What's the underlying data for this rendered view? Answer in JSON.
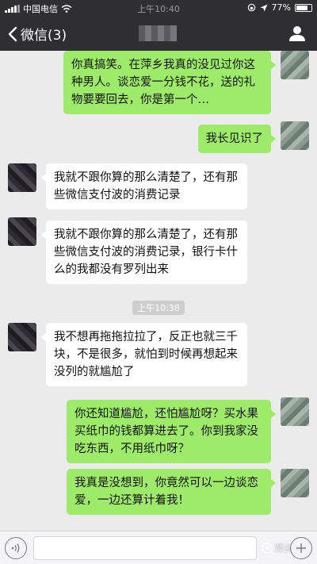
{
  "status_bar": {
    "carrier": "中国电信",
    "time": "上午10:40",
    "battery": "77%",
    "battery_level": 0.77
  },
  "nav": {
    "back_label": "微信(3)"
  },
  "messages": [
    {
      "side": "self",
      "text": "你真搞笑。在萍乡我真的没见过你这种男人。谈恋爱一分钱不花，送的礼物要要回去，你是第一个…"
    },
    {
      "side": "self",
      "text": "我长见识了"
    },
    {
      "side": "other",
      "text": "我就不跟你算的那么清楚了，还有那些微信支付波的消费记录"
    },
    {
      "side": "other",
      "text": "我就不跟你算的那么清楚了，还有那些微信支付波的消费记录，银行卡什么的我都没有罗列出来"
    },
    {
      "side": "other",
      "text": "我不想再拖拖拉拉了，反正也就三千块，不是很多，就怕到时候再想起来没列的就尴尬了"
    },
    {
      "side": "self",
      "text": "你还知道尴尬，还怕尴尬呀？买水果买纸巾的钱都算进去了。你到我家没吃东西，不用纸巾呀？"
    },
    {
      "side": "self",
      "text": "我真是没想到，你竟然可以一边谈恋爱，一边还算计着我！"
    }
  ],
  "timestamp": "上午10:38",
  "watermark": "萍乡"
}
